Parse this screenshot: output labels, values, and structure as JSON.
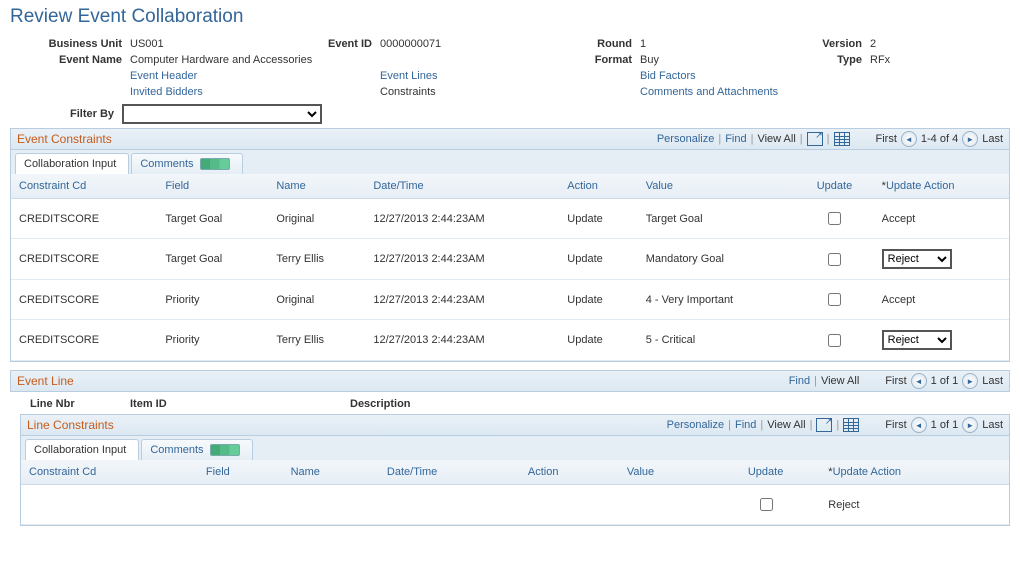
{
  "page_title": "Review Event Collaboration",
  "meta": {
    "business_unit_label": "Business Unit",
    "business_unit": "US001",
    "event_id_label": "Event ID",
    "event_id": "0000000071",
    "round_label": "Round",
    "round": "1",
    "version_label": "Version",
    "version": "2",
    "event_name_label": "Event Name",
    "event_name": "Computer Hardware and Accessories",
    "format_label": "Format",
    "format": "Buy",
    "type_label": "Type",
    "type": "RFx"
  },
  "links": {
    "event_header": "Event Header",
    "event_lines": "Event Lines",
    "bid_factors": "Bid Factors",
    "invited_bidders": "Invited Bidders",
    "constraints": "Constraints",
    "comments_attachments": "Comments and Attachments"
  },
  "filter_label": "Filter By",
  "section_event_constraints": {
    "title": "Event Constraints",
    "personalize": "Personalize",
    "find": "Find",
    "view_all": "View All",
    "first": "First",
    "nav_range": "1-4 of 4",
    "last": "Last",
    "tabs": {
      "collab": "Collaboration Input",
      "comments": "Comments"
    },
    "cols": {
      "constraint_cd": "Constraint Cd",
      "field": "Field",
      "name": "Name",
      "datetime": "Date/Time",
      "action": "Action",
      "value": "Value",
      "update": "Update",
      "update_action": "Update Action"
    },
    "rows": [
      {
        "cd": "CREDITSCORE",
        "field": "Target Goal",
        "name": "Original",
        "dt": "12/27/2013  2:44:23AM",
        "action": "Update",
        "value": "Target Goal",
        "upd": false,
        "ua_type": "text",
        "ua": "Accept"
      },
      {
        "cd": "CREDITSCORE",
        "field": "Target Goal",
        "name": "Terry Ellis",
        "dt": "12/27/2013  2:44:23AM",
        "action": "Update",
        "value": "Mandatory Goal",
        "upd": false,
        "ua_type": "select",
        "ua": "Reject"
      },
      {
        "cd": "CREDITSCORE",
        "field": "Priority",
        "name": "Original",
        "dt": "12/27/2013  2:44:23AM",
        "action": "Update",
        "value": "4 - Very Important",
        "upd": false,
        "ua_type": "text",
        "ua": "Accept"
      },
      {
        "cd": "CREDITSCORE",
        "field": "Priority",
        "name": "Terry Ellis",
        "dt": "12/27/2013  2:44:23AM",
        "action": "Update",
        "value": "5 - Critical",
        "upd": false,
        "ua_type": "select",
        "ua": "Reject"
      }
    ]
  },
  "section_event_line": {
    "title": "Event Line",
    "find": "Find",
    "view_all": "View All",
    "first": "First",
    "nav_range": "1 of 1",
    "last": "Last",
    "cols": {
      "line_nbr": "Line Nbr",
      "item_id": "Item ID",
      "description": "Description"
    }
  },
  "section_line_constraints": {
    "title": "Line Constraints",
    "personalize": "Personalize",
    "find": "Find",
    "view_all": "View All",
    "first": "First",
    "nav_range": "1 of 1",
    "last": "Last",
    "tabs": {
      "collab": "Collaboration Input",
      "comments": "Comments"
    },
    "cols": {
      "constraint_cd": "Constraint Cd",
      "field": "Field",
      "name": "Name",
      "datetime": "Date/Time",
      "action": "Action",
      "value": "Value",
      "update": "Update",
      "update_action": "Update Action"
    },
    "rows": [
      {
        "cd": "",
        "field": "",
        "name": "",
        "dt": "",
        "action": "",
        "value": "",
        "upd": false,
        "ua_type": "text",
        "ua": "Reject"
      }
    ]
  }
}
